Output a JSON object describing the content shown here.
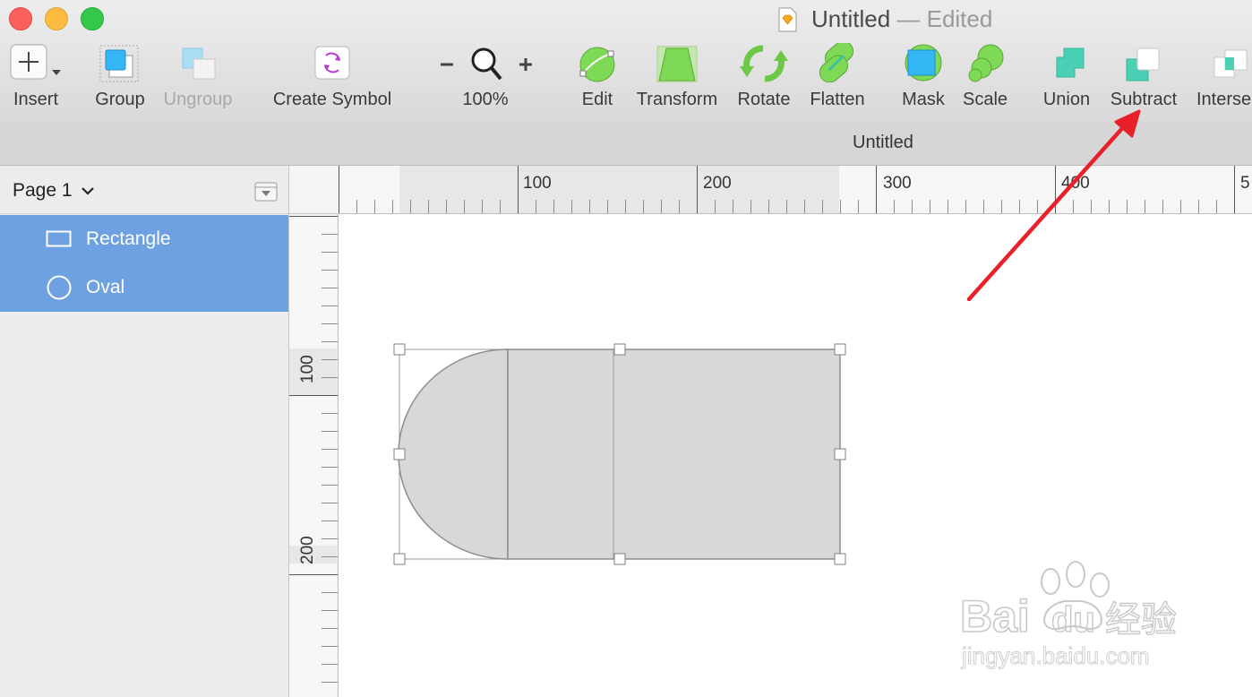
{
  "window": {
    "title": "Untitled",
    "title_suffix": " — Edited"
  },
  "toolbar": {
    "insert": "Insert",
    "group": "Group",
    "ungroup": "Ungroup",
    "create_symbol": "Create Symbol",
    "zoom": "100%",
    "edit": "Edit",
    "transform": "Transform",
    "rotate": "Rotate",
    "flatten": "Flatten",
    "mask": "Mask",
    "scale": "Scale",
    "union": "Union",
    "subtract": "Subtract",
    "intersect": "Interse"
  },
  "tab": {
    "title": "Untitled"
  },
  "sidebar": {
    "page": "Page 1",
    "layers": [
      {
        "name": "Rectangle",
        "icon": "rectangle-icon"
      },
      {
        "name": "Oval",
        "icon": "oval-icon"
      }
    ]
  },
  "rulers": {
    "horizontal": [
      "100",
      "200",
      "300",
      "400",
      "5"
    ],
    "vertical": [
      "100",
      "200"
    ]
  },
  "watermark": {
    "brand": "Bai",
    "brand_end": "du",
    "cn": "经验",
    "url": "jingyan.baidu.com"
  },
  "colors": {
    "selection": "#6ea1e2",
    "shape_fill": "#d8d8d8",
    "arrow": "#e8202a"
  }
}
